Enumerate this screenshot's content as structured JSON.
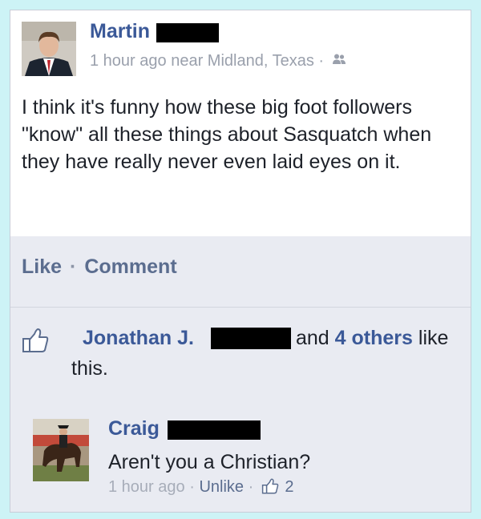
{
  "post": {
    "author": "Martin",
    "time": "1 hour ago",
    "location": "near Midland, Texas",
    "separator": "·",
    "audience_icon": "friends-icon",
    "text": "I think it's funny how these big foot followers \"know\" all these things about Sasquatch when they have really never even laid eyes on it."
  },
  "actions": {
    "like": "Like",
    "dot": "·",
    "comment": "Comment"
  },
  "likes": {
    "icon": "thumbs-up-icon",
    "liker": "Jonathan J.",
    "connector": "and",
    "others": "4 others",
    "suffix": "like",
    "line2": "this."
  },
  "comment": {
    "author": "Craig",
    "text": "Aren't you a Christian?",
    "time": "1 hour ago",
    "sep1": "·",
    "unlike": "Unlike",
    "sep2": "·",
    "like_icon": "thumbs-up-icon",
    "like_count": "2"
  },
  "colors": {
    "link": "#3b5998",
    "background": "#cdf3f6",
    "card": "#e9ebf2"
  }
}
